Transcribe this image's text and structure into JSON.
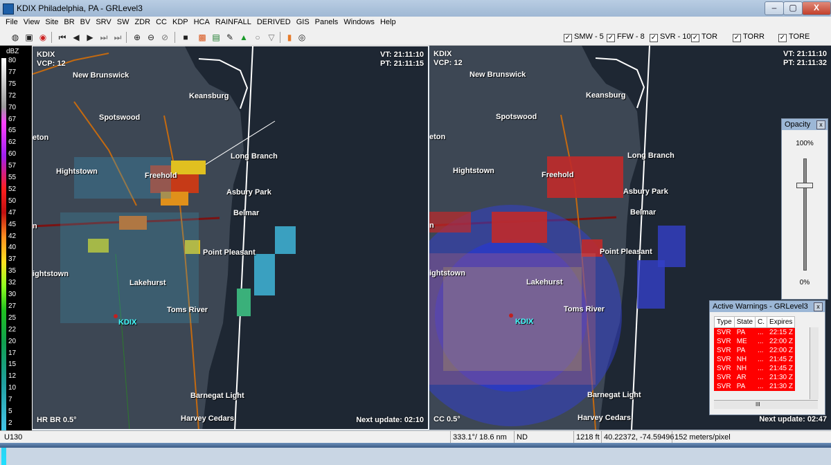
{
  "window": {
    "title": "KDIX Philadelphia, PA - GRLevel3",
    "min_symbol": "–",
    "max_symbol": "▢",
    "close_symbol": "X"
  },
  "menu": [
    "File",
    "View",
    "Site",
    "BR",
    "BV",
    "SRV",
    "SW",
    "ZDR",
    "CC",
    "KDP",
    "HCA",
    "RAINFALL",
    "DERIVED",
    "GIS",
    "Panels",
    "Windows",
    "Help"
  ],
  "toolbar": {
    "checks": [
      {
        "label": "SMW - 5",
        "checked": true
      },
      {
        "label": "FFW - 8",
        "checked": true
      },
      {
        "label": "SVR - 10",
        "checked": true
      },
      {
        "label": "TOR",
        "checked": true
      },
      {
        "label": "TORR",
        "checked": true
      },
      {
        "label": "TORE",
        "checked": true
      }
    ]
  },
  "color_scale": {
    "unit": "dBZ",
    "labels": [
      "80",
      "77",
      "75",
      "72",
      "70",
      "67",
      "65",
      "62",
      "60",
      "57",
      "55",
      "52",
      "50",
      "47",
      "45",
      "42",
      "40",
      "37",
      "35",
      "32",
      "30",
      "27",
      "25",
      "22",
      "20",
      "17",
      "15",
      "12",
      "10",
      "7",
      "5",
      "2"
    ]
  },
  "left_panel": {
    "site": "KDIX",
    "vcp": "VCP: 12",
    "vt": "VT: 21:11:10",
    "pt": "PT: 21:11:15",
    "product": "HR BR 0.5°",
    "next_update": "Next update: 02:10"
  },
  "right_panel": {
    "site": "KDIX",
    "vcp": "VCP: 12",
    "vt": "VT: 21:11:10",
    "pt": "PT: 21:11:32",
    "product": "CC 0.5°",
    "next_update": "Next update: 02:47"
  },
  "cities": {
    "new_brunswick": "New Brunswick",
    "keansburg": "Keansburg",
    "spotswood": "Spotswood",
    "eton": "eton",
    "hightstown": "Hightstown",
    "freehold": "Freehold",
    "long_branch": "Long Branch",
    "asbury_park": "Asbury Park",
    "belmar": "Belmar",
    "n": "n",
    "point_pleasant": "Point Pleasant",
    "ightstown": "ightstown",
    "lakehurst": "Lakehurst",
    "toms_river": "Toms River",
    "kdix": "KDIX",
    "barnegat_light": "Barnegat Light",
    "harvey_cedars": "Harvey Cedars"
  },
  "opacity_window": {
    "title": "Opacity",
    "close": "x",
    "top_label": "100%",
    "bottom_label": "0%"
  },
  "warnings_window": {
    "title": "Active Warnings - GRLevel3",
    "close": "x",
    "columns": [
      "Type",
      "State",
      "C.",
      "Expires"
    ],
    "rows": [
      [
        "SVR",
        "PA",
        "...",
        "22:15 Z"
      ],
      [
        "SVR",
        "ME",
        "...",
        "22:00 Z"
      ],
      [
        "SVR",
        "PA",
        "...",
        "22:00 Z"
      ],
      [
        "SVR",
        "NH",
        "...",
        "21:45 Z"
      ],
      [
        "SVR",
        "NH",
        "...",
        "21:45 Z"
      ],
      [
        "SVR",
        "AR",
        "...",
        "21:30 Z"
      ],
      [
        "SVR",
        "PA",
        "...",
        "21:30 Z"
      ]
    ],
    "scroll_thumb": "III"
  },
  "status": {
    "code": "U130",
    "bearing": "333.1°/ 18.6 nm",
    "value": "ND",
    "height": "1218 ft",
    "latlon": "40.22372, -74.59496",
    "resolution": "152 meters/pixel"
  },
  "colors": {
    "warning_red": "#ff0000",
    "radar_bg": "#26303c",
    "ocean": "#1e2733",
    "highway": "#8b1b1b",
    "coastline": "#ffffff"
  }
}
